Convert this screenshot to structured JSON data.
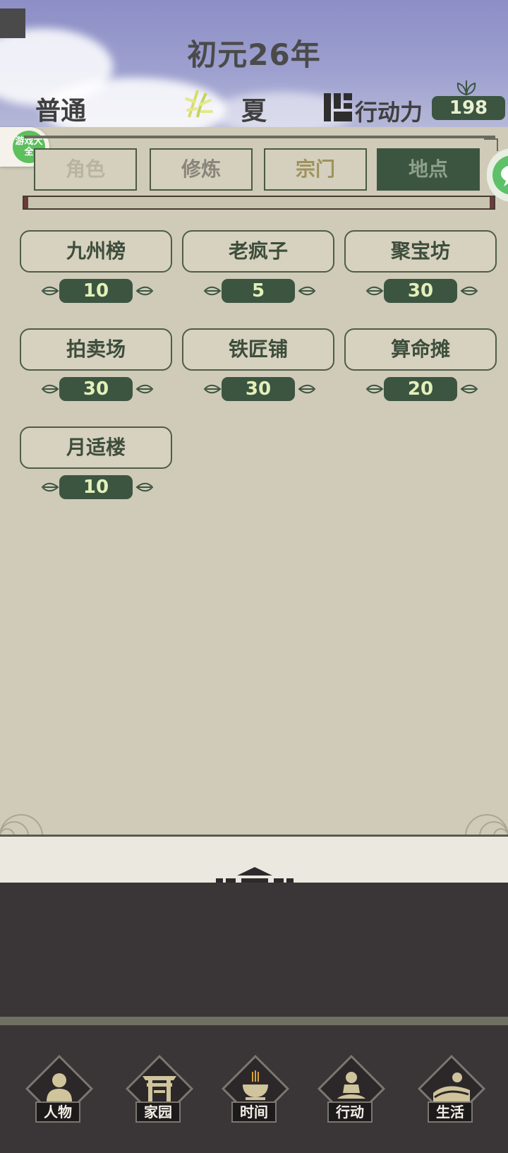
{
  "header": {
    "year_title": "初元26年",
    "difficulty": "普通",
    "season": "夏",
    "action_points_label": "行动力",
    "action_points_value": "198"
  },
  "side_badges": {
    "game_center_label": "游戏大全"
  },
  "tabs": [
    {
      "label": "角色",
      "active": false
    },
    {
      "label": "修炼",
      "active": false
    },
    {
      "label": "宗门",
      "active": false
    },
    {
      "label": "地点",
      "active": true
    }
  ],
  "locations": [
    {
      "name": "九州榜",
      "cost": "10"
    },
    {
      "name": "老疯子",
      "cost": "5"
    },
    {
      "name": "聚宝坊",
      "cost": "30"
    },
    {
      "name": "拍卖场",
      "cost": "30"
    },
    {
      "name": "铁匠铺",
      "cost": "30"
    },
    {
      "name": "算命摊",
      "cost": "20"
    },
    {
      "name": "月适楼",
      "cost": "10"
    }
  ],
  "bottom_nav": [
    {
      "label": "人物",
      "icon": "person-icon"
    },
    {
      "label": "家园",
      "icon": "gate-icon"
    },
    {
      "label": "时间",
      "icon": "incense-burner-icon"
    },
    {
      "label": "行动",
      "icon": "meditating-figure-icon"
    },
    {
      "label": "生活",
      "icon": "sun-landscape-icon"
    }
  ],
  "colors": {
    "accent_green": "#3c5541",
    "parchment": "#cfcbb8",
    "sky": "#8c8ec6",
    "dark_panel": "#3a3536"
  }
}
